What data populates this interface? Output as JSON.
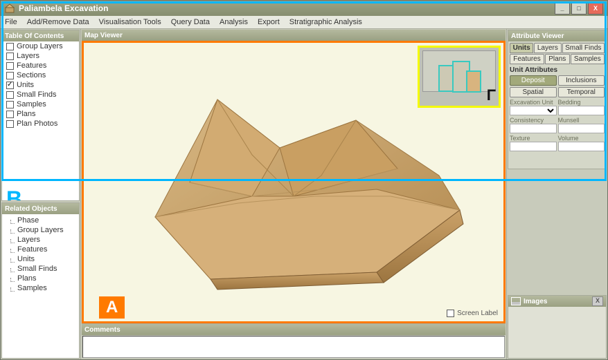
{
  "window": {
    "title": "Paliambela Excavation"
  },
  "menu": {
    "file": "File",
    "add_remove": "Add/Remove Data",
    "vis_tools": "Visualisation Tools",
    "query": "Query Data",
    "analysis": "Analysis",
    "export": "Export",
    "strat": "Stratigraphic Analysis"
  },
  "toc": {
    "title": "Table Of Contents",
    "items": [
      {
        "label": "Group Layers",
        "checked": false
      },
      {
        "label": "Layers",
        "checked": false
      },
      {
        "label": "Features",
        "checked": false
      },
      {
        "label": "Sections",
        "checked": false
      },
      {
        "label": "Units",
        "checked": true
      },
      {
        "label": "Small Finds",
        "checked": false
      },
      {
        "label": "Samples",
        "checked": false
      },
      {
        "label": "Plans",
        "checked": false
      },
      {
        "label": "Plan Photos",
        "checked": false
      }
    ]
  },
  "related": {
    "title": "Related Objects",
    "items": [
      "Phase",
      "Group Layers",
      "Layers",
      "Features",
      "Units",
      "Small Finds",
      "Plans",
      "Samples"
    ]
  },
  "mapviewer": {
    "title": "Map Viewer",
    "screen_label": "Screen Label"
  },
  "comments": {
    "title": "Comments"
  },
  "attrib": {
    "title": "Attribute Viewer",
    "tabs_row1": [
      "Units",
      "Layers",
      "Small Finds"
    ],
    "tabs_row2": [
      "Features",
      "Plans",
      "Samples"
    ],
    "active_tab": "Units",
    "section_label": "Unit Attributes",
    "btns_row1": [
      "Deposit",
      "Inclusions"
    ],
    "btns_row2": [
      "Spatial",
      "Temporal"
    ],
    "active_btn": "Deposit",
    "fields": {
      "excav_unit": "Excavation Unit",
      "bedding": "Bedding",
      "consistency": "Consistency",
      "munsell": "Munsell",
      "texture": "Texture",
      "volume": "Volume"
    }
  },
  "images": {
    "title": "Images"
  },
  "markers": {
    "A": "A",
    "B": "B",
    "G": "Γ"
  }
}
